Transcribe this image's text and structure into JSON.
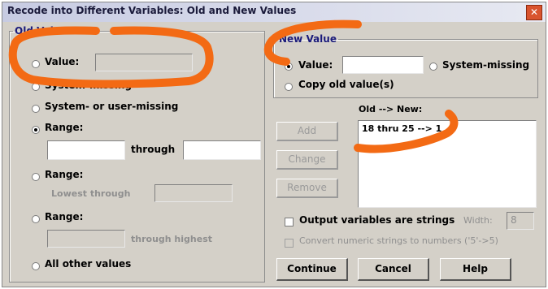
{
  "window": {
    "title": "Recode into Different Variables: Old and New Values"
  },
  "old_value": {
    "legend": "Old Value",
    "value_label": "Value:",
    "system_missing_label": "System-missing",
    "sys_user_missing_label": "System- or user-missing",
    "range_label": "Range:",
    "through_label": "through",
    "range_lowest_label": "Range:",
    "lowest_through_label": "Lowest through",
    "range_highest_label": "Range:",
    "through_highest_label": "through highest",
    "all_other_label": "All other values",
    "selected_option": "Range"
  },
  "new_value": {
    "legend": "New Value",
    "value_label": "Value:",
    "system_missing_label": "System-missing",
    "copy_old_label": "Copy old value(s)",
    "selected_option": "Value"
  },
  "mapping": {
    "header": "Old --> New:",
    "items": [
      "18 thru 25 --> 1"
    ]
  },
  "actions": {
    "add": "Add",
    "change": "Change",
    "remove": "Remove"
  },
  "options": {
    "output_strings_label": "Output variables are strings",
    "width_label": "Width:",
    "width_value": "8",
    "convert_label": "Convert numeric strings to numbers ('5'->5)"
  },
  "buttons": {
    "continue": "Continue",
    "cancel": "Cancel",
    "help": "Help"
  },
  "colors": {
    "annotation": "#f36a14",
    "dialog_bg": "#d4d0c8"
  },
  "icons": {
    "close": "close-icon"
  }
}
